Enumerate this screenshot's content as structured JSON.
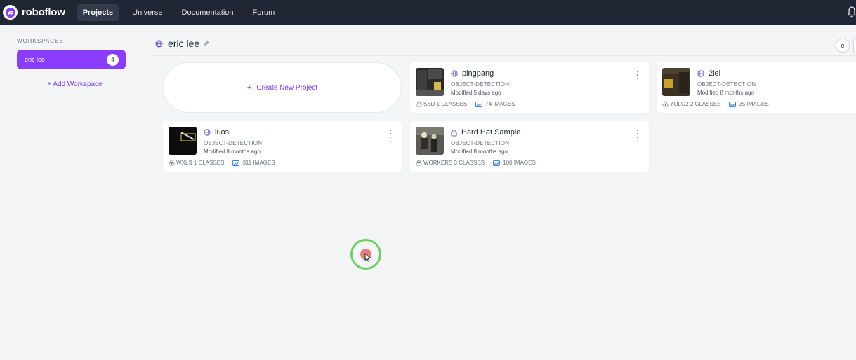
{
  "nav": {
    "brand": "roboflow",
    "items": [
      {
        "label": "Projects",
        "active": true
      },
      {
        "label": "Universe",
        "active": false
      },
      {
        "label": "Documentation",
        "active": false
      },
      {
        "label": "Forum",
        "active": false
      }
    ]
  },
  "sidebar": {
    "heading": "WORKSPACES",
    "workspace": {
      "name": "eric lee",
      "count": "4"
    },
    "add_label": "+ Add Workspace"
  },
  "header": {
    "title": "eric lee",
    "avatar_initial": "e"
  },
  "create": {
    "plus": "+",
    "label": "Create New Project"
  },
  "projects": [
    {
      "name": "pingpang",
      "type": "OBJECT-DETECTION",
      "modified": "Modified 5 days ago",
      "classes": "SSD 1 CLASSES",
      "images": "74 IMAGES",
      "visibility": "public"
    },
    {
      "name": "2lei",
      "type": "OBJECT-DETECTION",
      "modified": "Modified 8 months ago",
      "classes": "YOLO2 2 CLASSES",
      "images": "35 IMAGES",
      "visibility": "public"
    },
    {
      "name": "luosi",
      "type": "OBJECT-DETECTION",
      "modified": "Modified 8 months ago",
      "classes": "WXLS 1 CLASSES",
      "images": "311 IMAGES",
      "visibility": "public"
    },
    {
      "name": "Hard Hat Sample",
      "type": "OBJECT-DETECTION",
      "modified": "Modified 8 months ago",
      "classes": "WORKERS 3 CLASSES",
      "images": "100 IMAGES",
      "visibility": "private"
    }
  ],
  "colors": {
    "accent": "#8b3dff",
    "nav_bg": "#1f2735",
    "link": "#7c3aed",
    "image_icon": "#3b82f6"
  }
}
